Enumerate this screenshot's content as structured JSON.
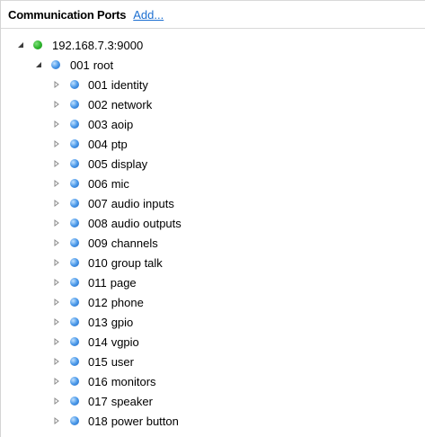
{
  "header": {
    "title": "Communication Ports",
    "add_link": "Add..."
  },
  "tree": {
    "host": {
      "label": "192.168.7.3:9000",
      "status_color": "#2bb32a",
      "expanded": true
    },
    "root": {
      "number": "001",
      "name": "root",
      "expanded": true
    },
    "children": [
      {
        "number": "001",
        "name": "identity"
      },
      {
        "number": "002",
        "name": "network"
      },
      {
        "number": "003",
        "name": "aoip"
      },
      {
        "number": "004",
        "name": "ptp"
      },
      {
        "number": "005",
        "name": "display"
      },
      {
        "number": "006",
        "name": "mic"
      },
      {
        "number": "007",
        "name": "audio inputs"
      },
      {
        "number": "008",
        "name": "audio outputs"
      },
      {
        "number": "009",
        "name": "channels"
      },
      {
        "number": "010",
        "name": "group talk"
      },
      {
        "number": "011",
        "name": "page"
      },
      {
        "number": "012",
        "name": "phone"
      },
      {
        "number": "013",
        "name": "gpio"
      },
      {
        "number": "014",
        "name": "vgpio"
      },
      {
        "number": "015",
        "name": "user"
      },
      {
        "number": "016",
        "name": "monitors"
      },
      {
        "number": "017",
        "name": "speaker"
      },
      {
        "number": "018",
        "name": "power button"
      }
    ]
  },
  "icons": {
    "expanded_toggle": "triangle-down-right-icon",
    "collapsed_toggle": "triangle-right-outline-icon",
    "node": "blue-sphere-icon",
    "host": "green-sphere-icon"
  },
  "colors": {
    "link": "#1c6fd1",
    "node_blue": "#4a98e8",
    "host_green": "#2bb32a"
  }
}
